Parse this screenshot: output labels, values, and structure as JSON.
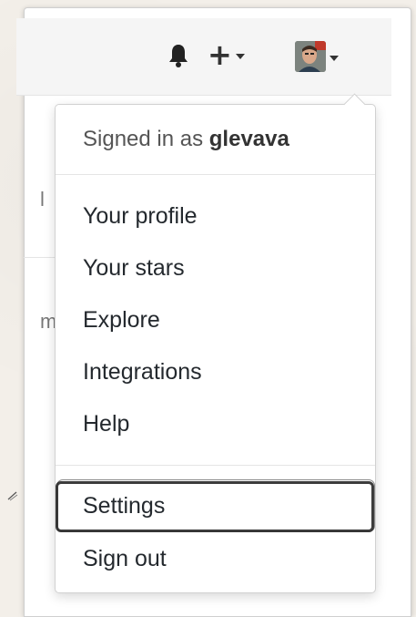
{
  "header": {
    "notifications_icon": "bell-icon",
    "create_menu_icon": "plus-icon",
    "avatar_alt": "user-avatar"
  },
  "background": {
    "fragment_1": "l",
    "fragment_2": "m"
  },
  "dropdown": {
    "signed_in_prefix": "Signed in as",
    "username": "glevava",
    "items": [
      {
        "label": "Your profile"
      },
      {
        "label": "Your stars"
      },
      {
        "label": "Explore"
      },
      {
        "label": "Integrations"
      },
      {
        "label": "Help"
      },
      {
        "label": "Settings"
      },
      {
        "label": "Sign out"
      }
    ],
    "highlighted_item": "Settings"
  },
  "colors": {
    "header_bg": "#f5f5f5",
    "text": "#24292e",
    "annotation": "#3c3c3c"
  }
}
